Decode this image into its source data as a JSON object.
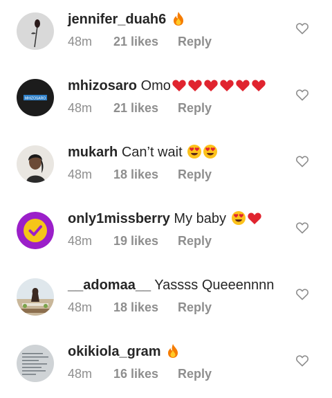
{
  "comments": [
    {
      "username": "jennifer_duah6",
      "text": "",
      "emojis": [
        "fire"
      ],
      "time": "48m",
      "likes": "21 likes",
      "reply": "Reply",
      "avatar": "rose-avatar"
    },
    {
      "username": "mhizosaro",
      "text": "Omo",
      "emojis": [
        "red-heart",
        "red-heart",
        "red-heart",
        "red-heart",
        "red-heart",
        "red-heart"
      ],
      "time": "48m",
      "likes": "21 likes",
      "reply": "Reply",
      "avatar": "logo-avatar",
      "avatar_logo_text": "MHIZOSARO"
    },
    {
      "username": "mukarh",
      "text": "Can’t wait",
      "emojis": [
        "heart-eyes",
        "heart-eyes"
      ],
      "time": "48m",
      "likes": "18 likes",
      "reply": "Reply",
      "avatar": "portrait-avatar"
    },
    {
      "username": "only1missberry",
      "text": "My baby",
      "emojis": [
        "heart-eyes",
        "red-heart"
      ],
      "time": "48m",
      "likes": "19 likes",
      "reply": "Reply",
      "avatar": "check-badge-avatar"
    },
    {
      "username": "__adomaa__",
      "text": "Yassss Queeennnn",
      "emojis": [],
      "time": "48m",
      "likes": "18 likes",
      "reply": "Reply",
      "avatar": "beach-photo-avatar"
    },
    {
      "username": "okikiola_gram",
      "text": "",
      "emojis": [
        "fire"
      ],
      "time": "48m",
      "likes": "16 likes",
      "reply": "Reply",
      "avatar": "text-screenshot-avatar"
    }
  ],
  "colors": {
    "username": "#262626",
    "meta": "#8e8e8e",
    "heart_outline": "#8e8e8e",
    "badge_purple": "#9b1fc9",
    "badge_yellow": "#f5c518"
  }
}
